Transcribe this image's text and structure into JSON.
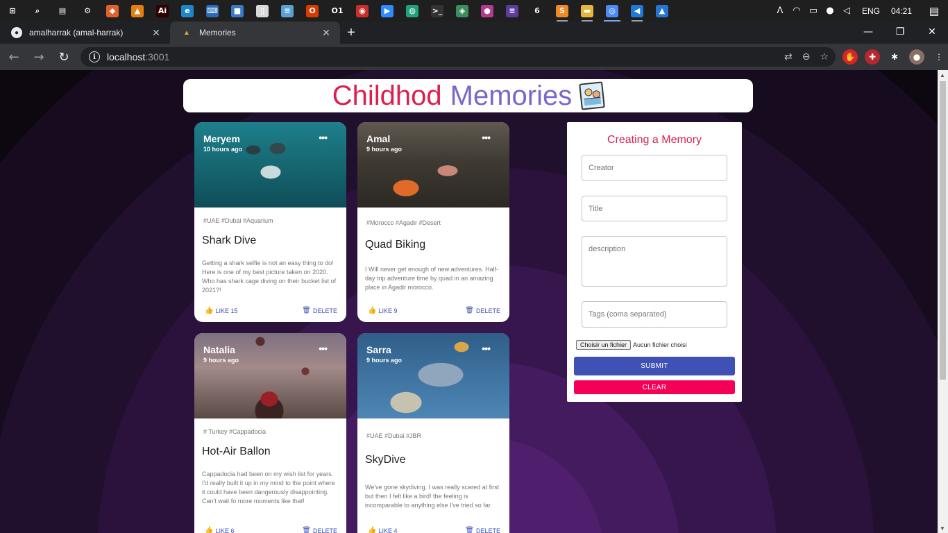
{
  "taskbar": {
    "apps": [
      {
        "name": "windows-start",
        "glyph": "⊞",
        "color": "#1f1f1f"
      },
      {
        "name": "search",
        "glyph": "⌕",
        "color": "#1f1f1f"
      },
      {
        "name": "task-view",
        "glyph": "▤",
        "color": "#1f1f1f"
      },
      {
        "name": "settings",
        "glyph": "⚙",
        "color": "#1f1f1f"
      },
      {
        "name": "paint",
        "glyph": "◆",
        "color": "#e0622b"
      },
      {
        "name": "vlc",
        "glyph": "▲",
        "color": "#e57e12"
      },
      {
        "name": "illustrator",
        "glyph": "Ai",
        "color": "#300000"
      },
      {
        "name": "edge",
        "glyph": "e",
        "color": "#1d86c8"
      },
      {
        "name": "keyboard",
        "glyph": "⌨",
        "color": "#2a68b8"
      },
      {
        "name": "store",
        "glyph": "■",
        "color": "#3a79c6"
      },
      {
        "name": "file",
        "glyph": "▯",
        "color": "#d9d9d9"
      },
      {
        "name": "notepad",
        "glyph": "≡",
        "color": "#5aa1d6"
      },
      {
        "name": "office",
        "glyph": "O",
        "color": "#d83b01"
      },
      {
        "name": "o1",
        "glyph": "O1",
        "color": "#1f1f1f"
      },
      {
        "name": "recorder",
        "glyph": "◉",
        "color": "#c9302c"
      },
      {
        "name": "zoom",
        "glyph": "▶",
        "color": "#2d8cff"
      },
      {
        "name": "color-app",
        "glyph": "◍",
        "color": "#20a17b"
      },
      {
        "name": "cmd",
        "glyph": ">_",
        "color": "#333333"
      },
      {
        "name": "git-tool",
        "glyph": "◈",
        "color": "#3c8d5c"
      },
      {
        "name": "app-pink",
        "glyph": "●",
        "color": "#b23a8f"
      },
      {
        "name": "app-bars",
        "glyph": "≡",
        "color": "#5b3e9c"
      },
      {
        "name": "app-red",
        "glyph": "6",
        "color": "#1f1f1f"
      },
      {
        "name": "sublime",
        "glyph": "S",
        "color": "#f08a24"
      },
      {
        "name": "file-explorer",
        "glyph": "▬",
        "color": "#e8b53b"
      },
      {
        "name": "chrome",
        "glyph": "◎",
        "color": "#4c8bf5"
      },
      {
        "name": "vscode",
        "glyph": "◀",
        "color": "#1e7ad6"
      },
      {
        "name": "photos",
        "glyph": "▲",
        "color": "#2476d1"
      }
    ],
    "tray": {
      "chevron": "ᐱ",
      "wifi": "◠",
      "battery": "▭",
      "mic": "●",
      "volume": "◁",
      "language": "ENG",
      "time": "04:21",
      "notification": "▤"
    }
  },
  "browser": {
    "tabs": [
      {
        "title": "amalharrak (amal-harrak)",
        "favicon": "●",
        "active": false
      },
      {
        "title": "Memories",
        "favicon": "▲",
        "active": true
      }
    ],
    "new_tab": "+",
    "window_controls": {
      "minimize": "—",
      "restore": "❐",
      "close": "✕"
    },
    "back": "←",
    "forward": "→",
    "reload": "↻",
    "url_host": "localhost",
    "url_port": ":3001",
    "translate": "⇄",
    "zoom": "⊖",
    "star": "☆",
    "extensions": [
      {
        "name": "adblock-extension",
        "glyph": "✋",
        "color": "#d8232a"
      },
      {
        "name": "red-extension",
        "glyph": "✚",
        "color": "#b7282e"
      },
      {
        "name": "puzzle-extension",
        "glyph": "✱",
        "color": "#35363a"
      },
      {
        "name": "profile-avatar",
        "glyph": "●",
        "color": "#8a6f64"
      },
      {
        "name": "menu-extension",
        "glyph": "⋮",
        "color": "#35363a"
      }
    ]
  },
  "app": {
    "title_part1": "Childhod",
    "title_part2": "Memories"
  },
  "posts": [
    {
      "creator": "Meryem",
      "time": "10 hours ago",
      "tags": "#UAE #Dubai #Aquarium",
      "title": "Shark Dive",
      "message": "Getting a shark selfie is not an easy thing to do! Here is one of my best picture taken on 2020. Who has shark cage diving on their bucket list of 2021?!",
      "like_label": "LIKE 15",
      "delete_label": "DELETE"
    },
    {
      "creator": "Amal",
      "time": "9 hours ago",
      "tags": "#Morocco #Agadir #Desert",
      "title": "Quad Biking",
      "message": "I Will never get enough of new adventures. Half-day trip adventure time by quad in an amazing place in Agadir morocco.",
      "like_label": "LIKE 9",
      "delete_label": "DELETE"
    },
    {
      "creator": "Natalia",
      "time": "9 hours ago",
      "tags": "# Turkey #Cappadocia",
      "title": "Hot-Air Ballon",
      "message": "Cappadocia had been on my wish list for years. I'd really built it up in my mind to the point where it could have been dangerously disappointing. Can't wait fo more moments like that!",
      "like_label": "LIKE 6",
      "delete_label": "DELETE"
    },
    {
      "creator": "Sarra",
      "time": "9 hours ago",
      "tags": "#UAE #Dubai #JBR",
      "title": "SkyDive",
      "message": "We've gone skydiving. I was really scared at first but then I felt like a bird! the feeling is incomparable to anything else I've tried so far.",
      "like_label": "LIKE 4",
      "delete_label": "DELETE"
    }
  ],
  "form": {
    "title": "Creating a Memory",
    "creator_placeholder": "Creator",
    "title_placeholder": "Title",
    "description_placeholder": "description",
    "tags_placeholder": "Tags (coma separated)",
    "file_button": "Choisir un fichier",
    "file_status": "Aucun fichier choisi",
    "submit_label": "SUBMIT",
    "clear_label": "CLEAR"
  },
  "icons": {
    "more": "•••",
    "thumb": "👍",
    "trash": "🗑"
  },
  "colors": {
    "title_red": "#dc1f4f",
    "title_purple": "#7b67c7",
    "primary": "#3f51b5",
    "secondary": "#f50057"
  }
}
